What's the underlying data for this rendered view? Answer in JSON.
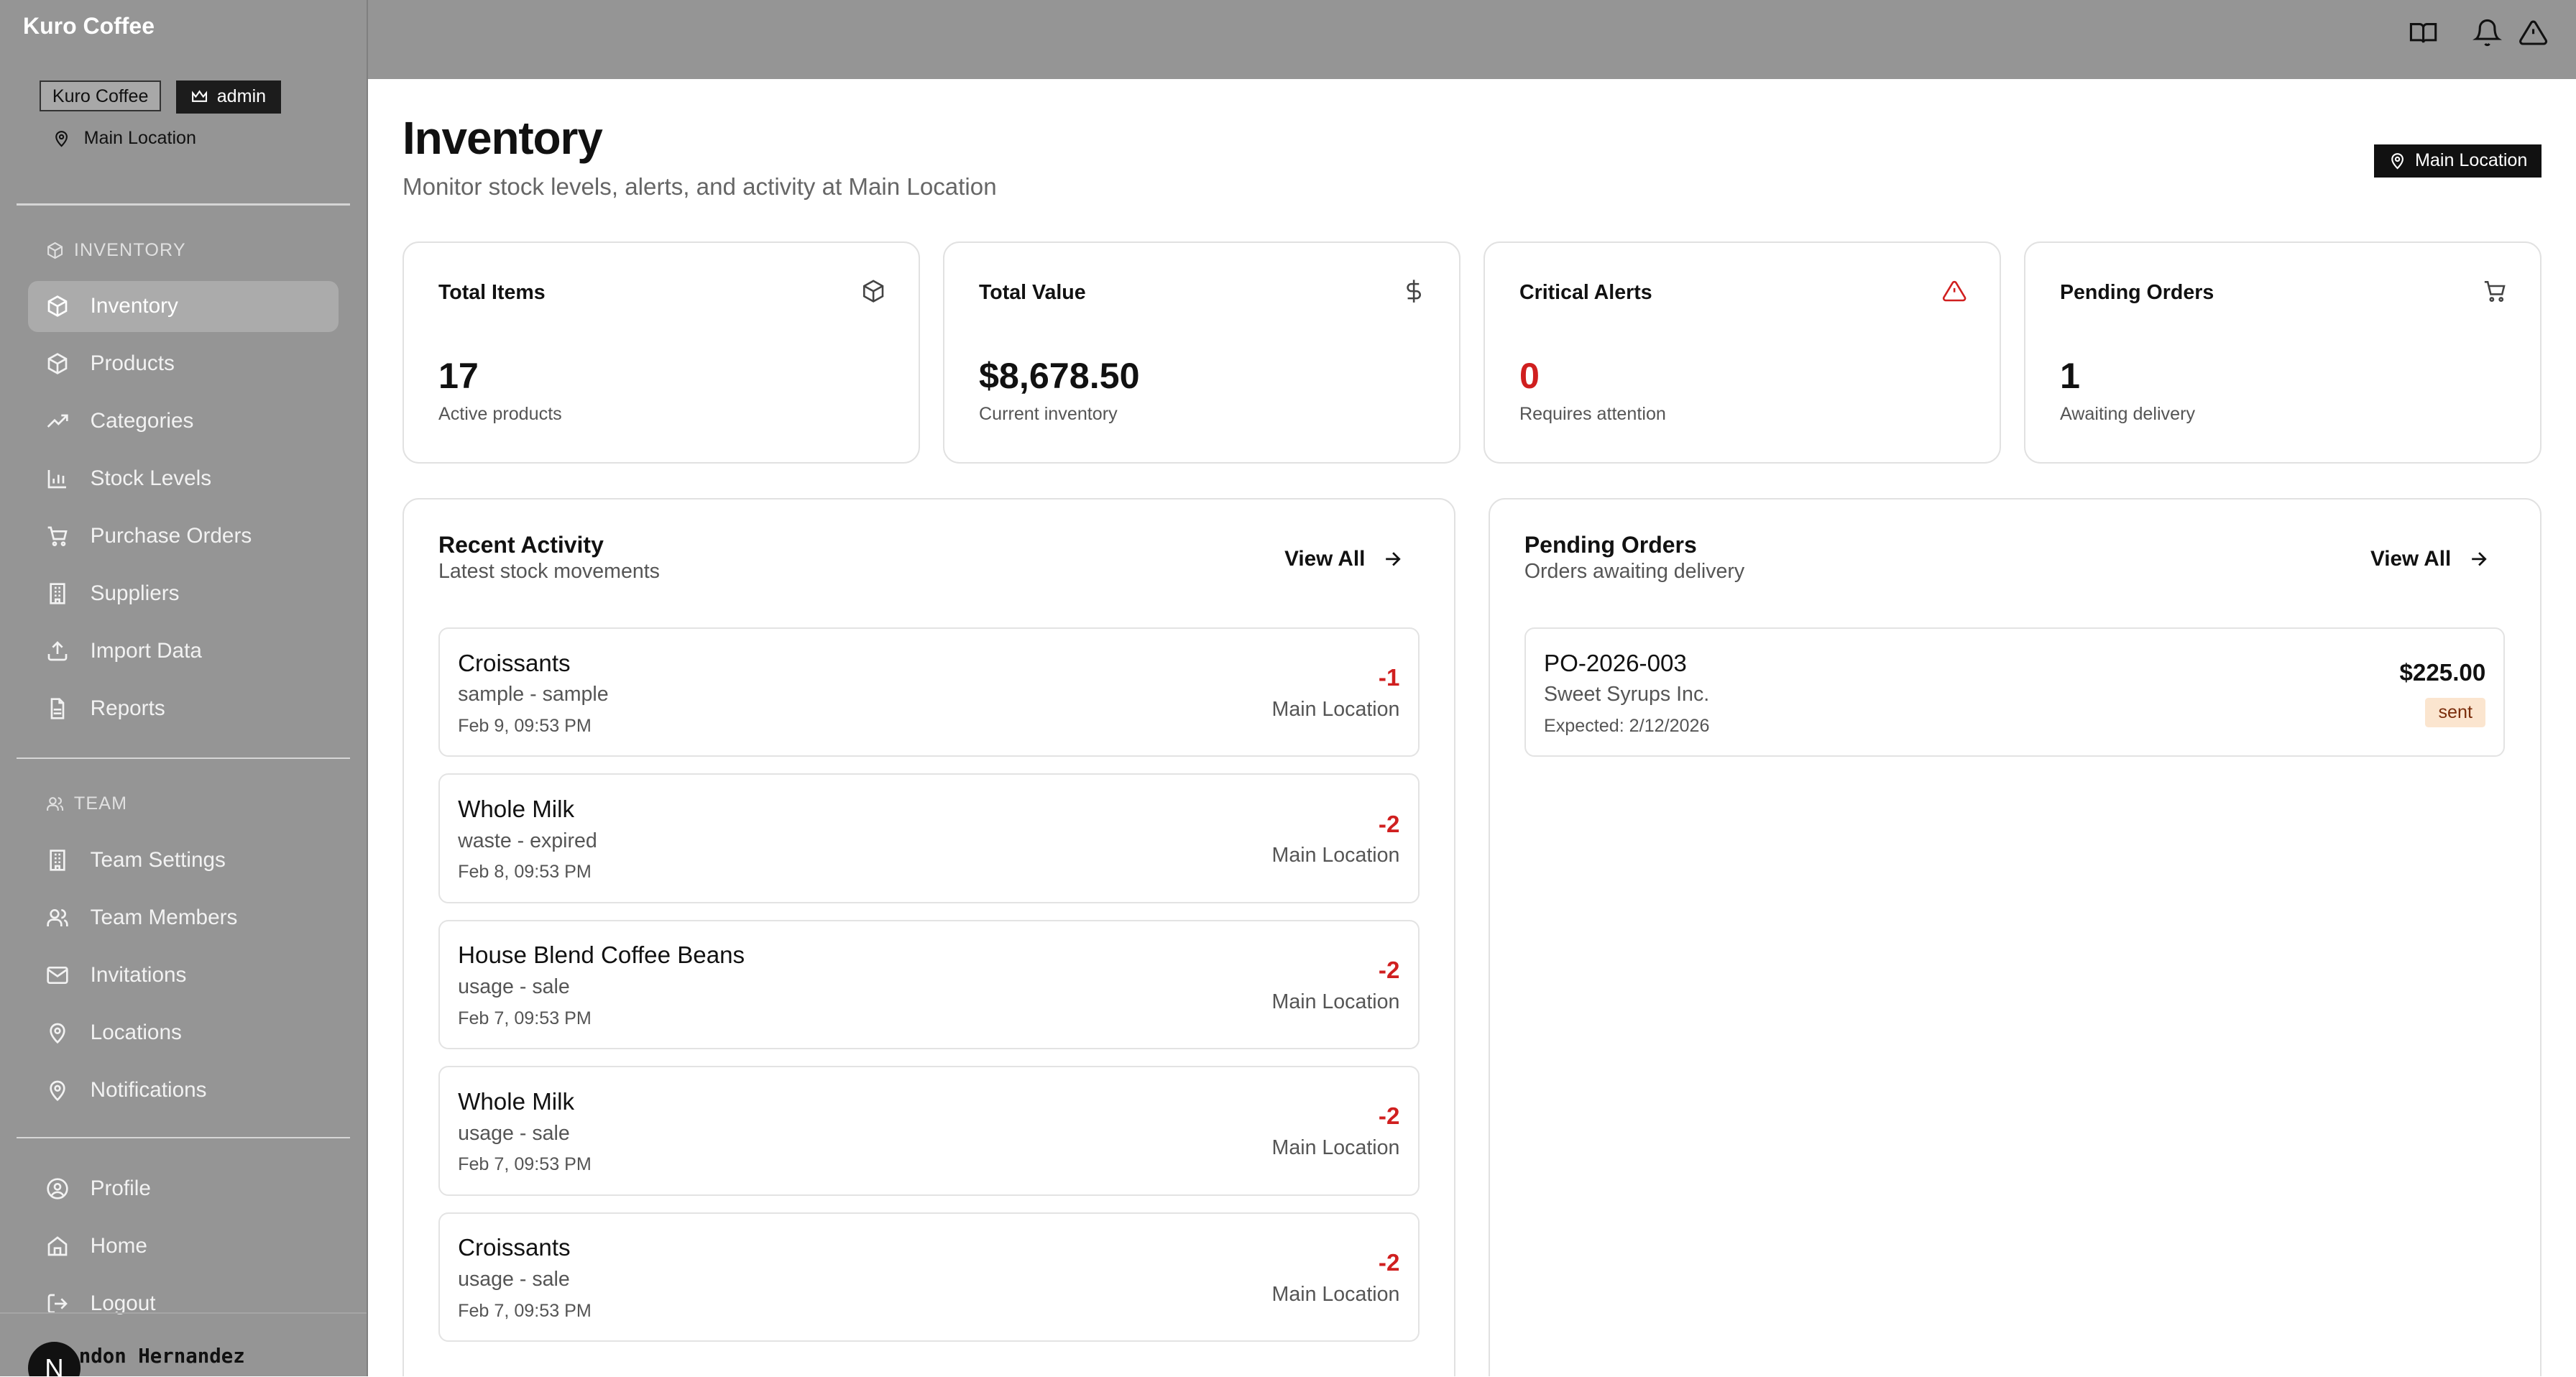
{
  "sidebar": {
    "brand": "Kuro Coffee",
    "org_badge": "Kuro Coffee",
    "role_badge": "admin",
    "location": "Main Location",
    "sections": [
      {
        "heading": "INVENTORY",
        "items": [
          {
            "label": "Inventory",
            "icon": "box-icon",
            "active": true
          },
          {
            "label": "Products",
            "icon": "box-icon"
          },
          {
            "label": "Categories",
            "icon": "trending-up-icon"
          },
          {
            "label": "Stock Levels",
            "icon": "bar-chart-icon"
          },
          {
            "label": "Purchase Orders",
            "icon": "cart-icon"
          },
          {
            "label": "Suppliers",
            "icon": "building-icon"
          },
          {
            "label": "Import Data",
            "icon": "upload-icon"
          },
          {
            "label": "Reports",
            "icon": "file-icon"
          }
        ]
      },
      {
        "heading": "TEAM",
        "items": [
          {
            "label": "Team Settings",
            "icon": "building-icon"
          },
          {
            "label": "Team Members",
            "icon": "users-icon"
          },
          {
            "label": "Invitations",
            "icon": "mail-icon"
          },
          {
            "label": "Locations",
            "icon": "map-pin-icon"
          },
          {
            "label": "Notifications",
            "icon": "map-pin-icon"
          }
        ]
      },
      {
        "heading": "",
        "items": [
          {
            "label": "Profile",
            "icon": "user-circle-icon"
          },
          {
            "label": "Home",
            "icon": "home-icon"
          },
          {
            "label": "Logout",
            "icon": "logout-icon"
          }
        ]
      }
    ],
    "user": {
      "avatar_letter": "N",
      "name": "ndon Hernandez"
    }
  },
  "header": {
    "title": "Inventory",
    "subtitle": "Monitor stock levels, alerts, and activity at Main Location",
    "location_badge": "Main Location",
    "icons": [
      "book-icon",
      "bell-icon",
      "alert-triangle-icon"
    ]
  },
  "stats": [
    {
      "title": "Total Items",
      "value": "17",
      "note": "Active products",
      "icon": "box-icon"
    },
    {
      "title": "Total Value",
      "value": "$8,678.50",
      "note": "Current inventory",
      "icon": "dollar-icon"
    },
    {
      "title": "Critical Alerts",
      "value": "0",
      "note": "Requires attention",
      "icon": "alert-triangle-icon",
      "accent": "#d01f1f"
    },
    {
      "title": "Pending Orders",
      "value": "1",
      "note": "Awaiting delivery",
      "icon": "cart-icon"
    }
  ],
  "recent_activity": {
    "title": "Recent Activity",
    "subtitle": "Latest stock movements",
    "view_all": "View All",
    "items": [
      {
        "name": "Croissants",
        "type": "sample - sample",
        "date": "Feb 9, 09:53 PM",
        "qty": "-1",
        "location": "Main Location"
      },
      {
        "name": "Whole Milk",
        "type": "waste - expired",
        "date": "Feb 8, 09:53 PM",
        "qty": "-2",
        "location": "Main Location"
      },
      {
        "name": "House Blend Coffee Beans",
        "type": "usage - sale",
        "date": "Feb 7, 09:53 PM",
        "qty": "-2",
        "location": "Main Location"
      },
      {
        "name": "Whole Milk",
        "type": "usage - sale",
        "date": "Feb 7, 09:53 PM",
        "qty": "-2",
        "location": "Main Location"
      },
      {
        "name": "Croissants",
        "type": "usage - sale",
        "date": "Feb 7, 09:53 PM",
        "qty": "-2",
        "location": "Main Location"
      }
    ]
  },
  "pending_orders": {
    "title": "Pending Orders",
    "subtitle": "Orders awaiting delivery",
    "view_all": "View All",
    "items": [
      {
        "number": "PO-2026-003",
        "supplier": "Sweet Syrups Inc.",
        "expected": "Expected: 2/12/2026",
        "amount": "$225.00",
        "status": "sent"
      }
    ]
  },
  "colors": {
    "sidebar_bg": "#959595",
    "negative": "#d01f1f",
    "status_sent_bg": "#fbe5cf"
  }
}
